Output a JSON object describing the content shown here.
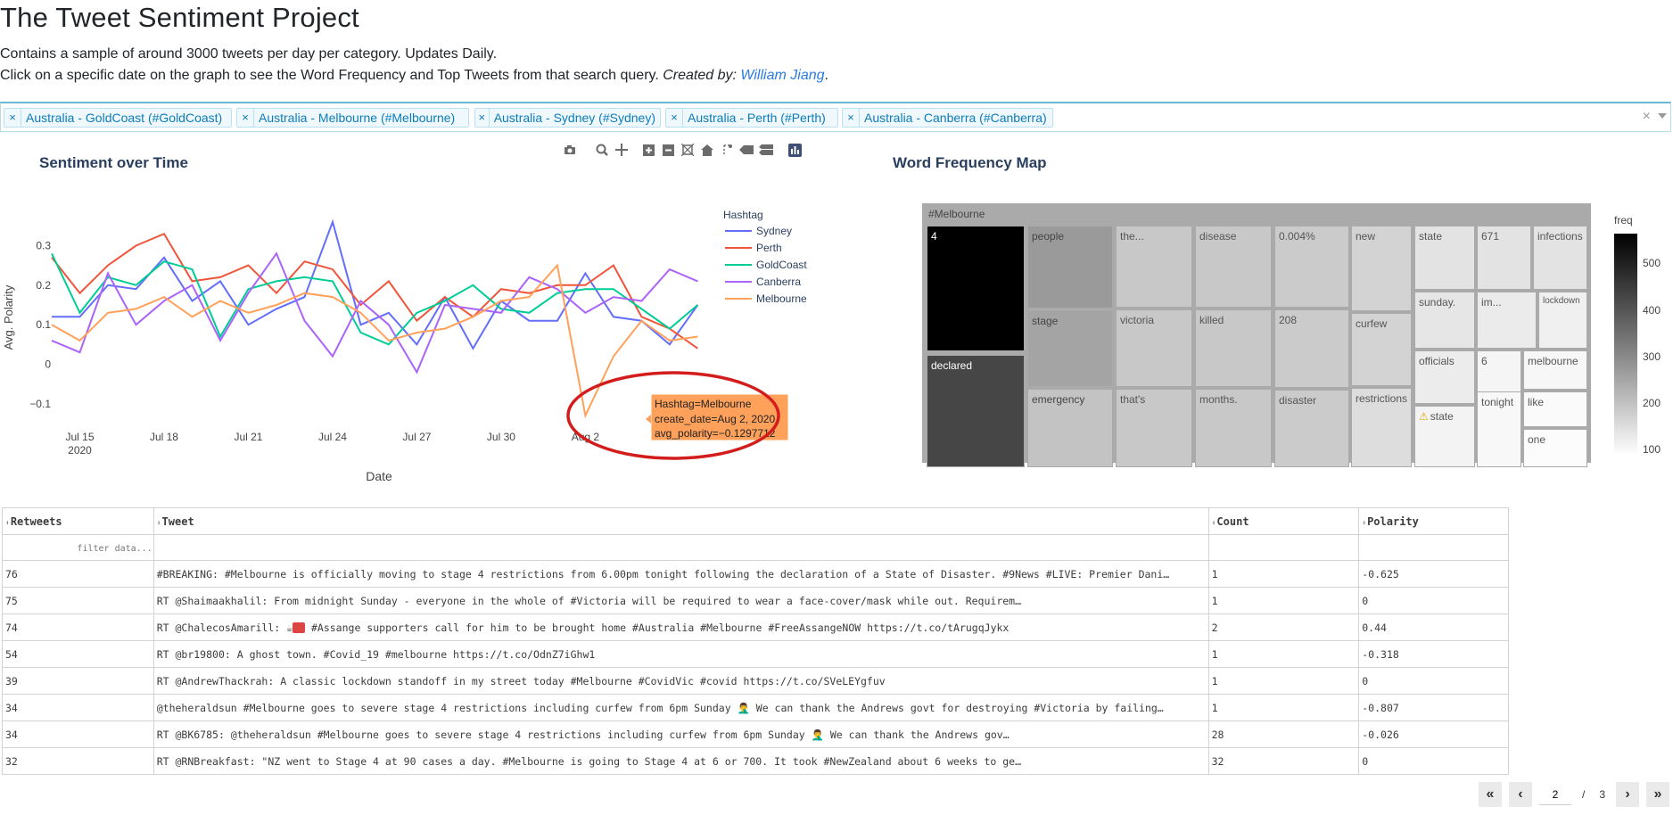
{
  "header": {
    "title": "The Tweet Sentiment Project",
    "line1": "Contains a sample of around 3000 tweets per day per category. Updates Daily.",
    "line2": "Click on a specific date on the graph to see the Word Frequency and Top Tweets from that search query.",
    "created_by": "Created by:",
    "author": "William Jiang",
    "period": "."
  },
  "filter": {
    "tags": [
      "Australia - GoldCoast (#GoldCoast)",
      "Australia - Melbourne (#Melbourne)",
      "Australia - Sydney (#Sydney)",
      "Australia - Perth (#Perth)",
      "Australia - Canberra (#Canberra)"
    ],
    "clear": "×"
  },
  "sentiment": {
    "title": "Sentiment over Time",
    "legend_title": "Hashtag",
    "tooltip": {
      "line1": "Hashtag=Melbourne",
      "line2": "create_date=Aug 2, 2020",
      "line3": "avg_polarity=−0.1297712"
    }
  },
  "chart_data": {
    "type": "line",
    "xlabel": "Date",
    "ylabel": "Avg. Polarity",
    "ylim": [
      -0.15,
      0.38
    ],
    "x_ticks": [
      "Jul 15\n2020",
      "Jul 18",
      "Jul 21",
      "Jul 24",
      "Jul 27",
      "Jul 30",
      "Aug 2"
    ],
    "y_ticks": [
      "0.3",
      "0.2",
      "0.1",
      "0",
      "−0.1"
    ],
    "x": [
      14,
      15,
      16,
      17,
      18,
      19,
      20,
      21,
      22,
      23,
      24,
      25,
      26,
      27,
      28,
      29,
      30,
      31,
      32,
      33,
      34,
      35,
      36,
      37
    ],
    "series": [
      {
        "name": "Sydney",
        "color": "#636efa",
        "values": [
          0.12,
          0.12,
          0.2,
          0.19,
          0.27,
          0.16,
          0.21,
          0.1,
          0.14,
          0.17,
          0.36,
          0.1,
          0.13,
          0.05,
          0.17,
          0.04,
          0.16,
          0.11,
          0.11,
          0.23,
          0.12,
          0.11,
          0.05,
          0.15
        ]
      },
      {
        "name": "Perth",
        "color": "#ef553b",
        "values": [
          0.27,
          0.18,
          0.25,
          0.3,
          0.33,
          0.21,
          0.22,
          0.25,
          0.18,
          0.26,
          0.24,
          0.15,
          0.21,
          0.11,
          0.17,
          0.12,
          0.19,
          0.18,
          0.2,
          0.2,
          0.25,
          0.12,
          0.09,
          0.04
        ]
      },
      {
        "name": "GoldCoast",
        "color": "#00cc96",
        "values": [
          0.28,
          0.13,
          0.22,
          0.2,
          0.26,
          0.24,
          0.07,
          0.19,
          0.21,
          0.22,
          0.21,
          0.08,
          0.05,
          0.13,
          0.16,
          0.2,
          0.14,
          0.13,
          0.18,
          0.19,
          0.19,
          0.14,
          0.09,
          0.15
        ]
      },
      {
        "name": "Canberra",
        "color": "#ab63fa",
        "values": [
          0.06,
          0.03,
          0.23,
          0.1,
          0.16,
          0.2,
          0.06,
          0.18,
          0.28,
          0.11,
          0.02,
          0.16,
          0.1,
          -0.02,
          0.15,
          0.14,
          0.13,
          0.22,
          0.19,
          0.13,
          0.17,
          0.16,
          0.24,
          0.21
        ]
      },
      {
        "name": "Melbourne",
        "color": "#ffa15a",
        "values": [
          0.1,
          0.06,
          0.13,
          0.14,
          0.17,
          0.12,
          0.16,
          0.13,
          0.15,
          0.18,
          0.17,
          0.13,
          0.06,
          0.08,
          0.09,
          0.12,
          0.16,
          0.17,
          0.25,
          -0.13,
          0.02,
          0.11,
          0.06,
          0.07
        ]
      }
    ]
  },
  "wordfreq": {
    "title": "Word Frequency Map",
    "root": "#Melbourne",
    "colorbar_title": "freq",
    "colorbar_ticks": [
      "500",
      "400",
      "300",
      "200",
      "100"
    ],
    "tiles": [
      {
        "label": "4",
        "shade": "#000000",
        "text": "#ffffff"
      },
      {
        "label": "declared",
        "shade": "#464646",
        "text": "#ffffff"
      },
      {
        "label": "people",
        "shade": "#9a9a9a",
        "text": "#444"
      },
      {
        "label": "stage",
        "shade": "#a4a4a4",
        "text": "#444"
      },
      {
        "label": "emergency",
        "shade": "#c3c3c3",
        "text": "#444"
      },
      {
        "label": "the...",
        "shade": "#c8c8c8",
        "text": "#555"
      },
      {
        "label": "victoria",
        "shade": "#c8c8c8",
        "text": "#555"
      },
      {
        "label": "that's",
        "shade": "#c8c8c8",
        "text": "#555"
      },
      {
        "label": "disease",
        "shade": "#c8c8c8",
        "text": "#555"
      },
      {
        "label": "killed",
        "shade": "#c8c8c8",
        "text": "#555"
      },
      {
        "label": "months.",
        "shade": "#c8c8c8",
        "text": "#555"
      },
      {
        "label": "0.004%",
        "shade": "#cbcbcb",
        "text": "#555"
      },
      {
        "label": "208",
        "shade": "#cbcbcb",
        "text": "#555"
      },
      {
        "label": "disaster",
        "shade": "#cbcbcb",
        "text": "#555"
      },
      {
        "label": "new",
        "shade": "#d3d3d3",
        "text": "#555"
      },
      {
        "label": "curfew",
        "shade": "#d3d3d3",
        "text": "#555"
      },
      {
        "label": "restrictions",
        "shade": "#dddddd",
        "text": "#555"
      },
      {
        "label": "state",
        "shade": "#e3e3e3",
        "text": "#555"
      },
      {
        "label": "671",
        "shade": "#e3e3e3",
        "text": "#555"
      },
      {
        "label": "infections",
        "shade": "#e3e3e3",
        "text": "#555"
      },
      {
        "label": "sunday.",
        "shade": "#e6e6e6",
        "text": "#555"
      },
      {
        "label": "im...",
        "shade": "#ebebeb",
        "text": "#555"
      },
      {
        "label": "lockdown",
        "shade": "#f0f0f0",
        "text": "#555"
      },
      {
        "label": "officials",
        "shade": "#ececec",
        "text": "#555"
      },
      {
        "label": "6",
        "shade": "#f5f5f5",
        "text": "#555"
      },
      {
        "label": "melbourne",
        "shade": "#f7f7f7",
        "text": "#555"
      },
      {
        "label": "state",
        "shade": "#f3f3f3",
        "text": "#555"
      },
      {
        "label": "tonight",
        "shade": "#f8f8f8",
        "text": "#555"
      },
      {
        "label": "like",
        "shade": "#fafafa",
        "text": "#555"
      },
      {
        "label": "one",
        "shade": "#fcfcfc",
        "text": "#555"
      }
    ]
  },
  "table": {
    "headers": [
      "Retweets",
      "Tweet",
      "Count",
      "Polarity"
    ],
    "filter_placeholder": "filter data...",
    "rows": [
      {
        "retweets": "76",
        "tweet": "#BREAKING: #Melbourne is officially moving to stage 4 restrictions from 6.00pm tonight following the declaration of a State of Disaster. #9News #LIVE: Premier Dani…",
        "count": "1",
        "polarity": "-0.625"
      },
      {
        "retweets": "75",
        "tweet": "RT @Shaimaakhalil: From midnight Sunday - everyone in the whole of #Victoria will be required to wear a face-cover/mask while out. Requirem…",
        "count": "1",
        "polarity": "0"
      },
      {
        "retweets": "74",
        "tweet_pre": "RT @ChalecosAmarill: ",
        "tweet": " #Assange supporters call for him to be brought home #Australia #Melbourne #FreeAssangeNOW https://t.co/tArugqJykx",
        "count": "2",
        "polarity": "0.44"
      },
      {
        "retweets": "54",
        "tweet": "RT @br19800: A ghost town. #Covid_19 #melbourne https://t.co/OdnZ7iGhw1",
        "count": "1",
        "polarity": "-0.318"
      },
      {
        "retweets": "39",
        "tweet": "RT @AndrewThackrah: A classic lockdown standoff in my street today #Melbourne #CovidVic #covid https://t.co/SVeLEYgfuv",
        "count": "1",
        "polarity": "0"
      },
      {
        "retweets": "34",
        "tweet": "@theheraldsun #Melbourne goes to severe stage 4 restrictions including curfew from 6pm Sunday 🤦‍♂️ We can thank the Andrews govt for destroying #Victoria by failing…",
        "count": "1",
        "polarity": "-0.807"
      },
      {
        "retweets": "34",
        "tweet": "RT @BK6785: @theheraldsun #Melbourne goes to severe stage 4 restrictions including curfew from 6pm Sunday 🤦‍♂️ We can thank the Andrews gov…",
        "count": "28",
        "polarity": "-0.026"
      },
      {
        "retweets": "32",
        "tweet": "RT @RNBreakfast: \"NZ went to Stage 4 at 90 cases a day. #Melbourne is going to Stage 4 at 6 or 700. It took #NewZealand about 6 weeks to ge…",
        "count": "32",
        "polarity": "0"
      }
    ]
  },
  "pager": {
    "first": "«",
    "prev": "‹",
    "current": "2",
    "sep": "/",
    "total": "3",
    "next": "›",
    "last": "»"
  }
}
